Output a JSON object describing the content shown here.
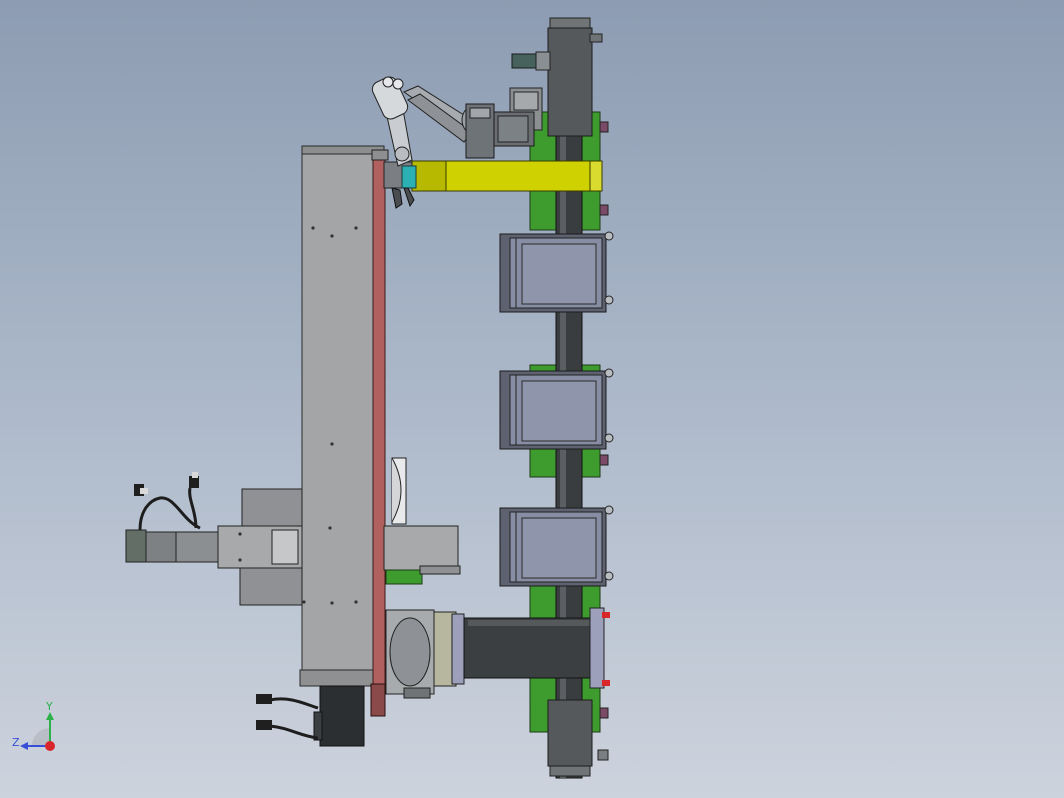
{
  "view": {
    "background_top": "#8d9cb2",
    "background_bottom": "#cdd3dd"
  },
  "triad": {
    "y_label": "Y",
    "z_label": "Z",
    "y_color": "#2bb04a",
    "z_color": "#3a4fd8",
    "origin_color": "#d8262b"
  },
  "colors": {
    "gantry_gray": "#a3a5a6",
    "rail_red": "#b0605e",
    "yellow_beam": "#cfd200",
    "green_plate": "#3e9c2f",
    "dark_column": "#3c3f42",
    "tray_body": "#8c93a7",
    "cyan_block": "#2bb1b4"
  }
}
